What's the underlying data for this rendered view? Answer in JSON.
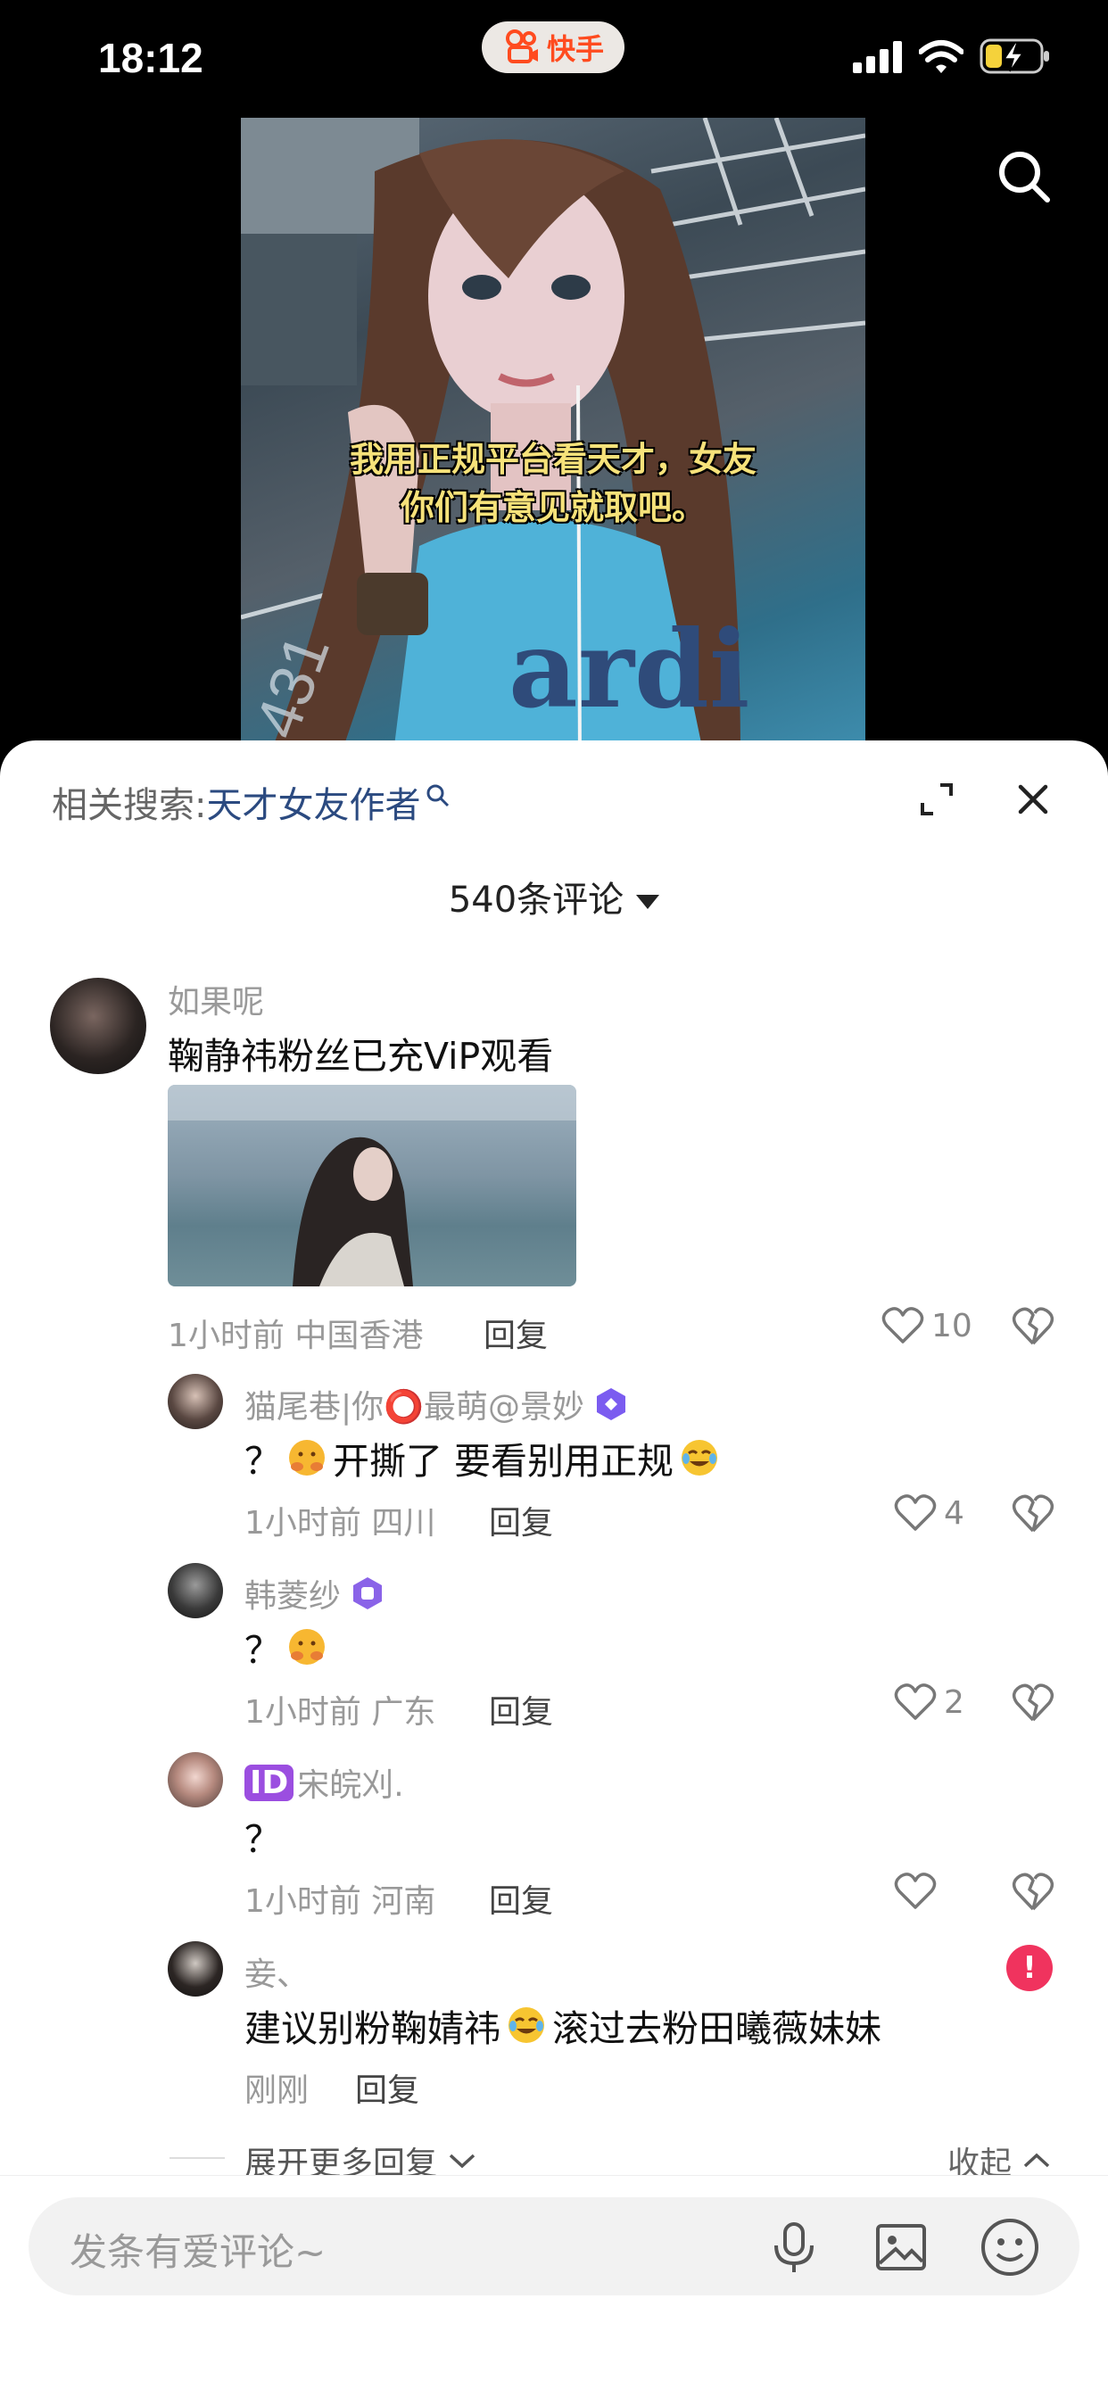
{
  "status_bar": {
    "time": "18:12",
    "app_name": "快手"
  },
  "video": {
    "caption_line1": "我用正规平台看天才，女友",
    "caption_line2": "你们有意见就取吧。",
    "shirt_text": "ardi"
  },
  "panel": {
    "related_label": "相关搜索:",
    "related_keyword": "天才女友作者",
    "comment_count": "540条评论"
  },
  "comments": [
    {
      "user": "如果呢",
      "text": "鞠静祎粉丝已充ViP观看",
      "time": "1小时前",
      "location": "中国香港",
      "reply_label": "回复",
      "likes": "10"
    }
  ],
  "replies": [
    {
      "user": "猫尾巷|你⭕最萌@景妙",
      "text_a": "？",
      "text_b": "开撕了  要看别用正规",
      "time": "1小时前",
      "location": "四川",
      "reply_label": "回复",
      "likes": "4",
      "badge": "purple-hex-badge-icon"
    },
    {
      "user": "韩菱纱",
      "text_a": "？",
      "text_b": "",
      "time": "1小时前",
      "location": "广东",
      "reply_label": "回复",
      "likes": "2",
      "badge": "purple-hex-badge-icon"
    },
    {
      "user_prefix": "ID",
      "user": "宋皖刈.",
      "text_a": "？",
      "time": "1小时前",
      "location": "河南",
      "reply_label": "回复",
      "likes": ""
    },
    {
      "user": "妾、",
      "text_a": "建议别粉鞠婧祎",
      "text_b": "滚过去粉田曦薇妹妹",
      "time": "刚刚",
      "reply_label": "回复"
    }
  ],
  "thread_controls": {
    "expand_more": "展开更多回复",
    "collapse": "收起"
  },
  "input_bar": {
    "placeholder": "发条有爱评论~"
  },
  "colors": {
    "keyword_blue": "#2b4a80",
    "alert_red": "#f0335e",
    "brand_orange": "#ff4b1f",
    "badge_purple": "#7b5cf0"
  }
}
